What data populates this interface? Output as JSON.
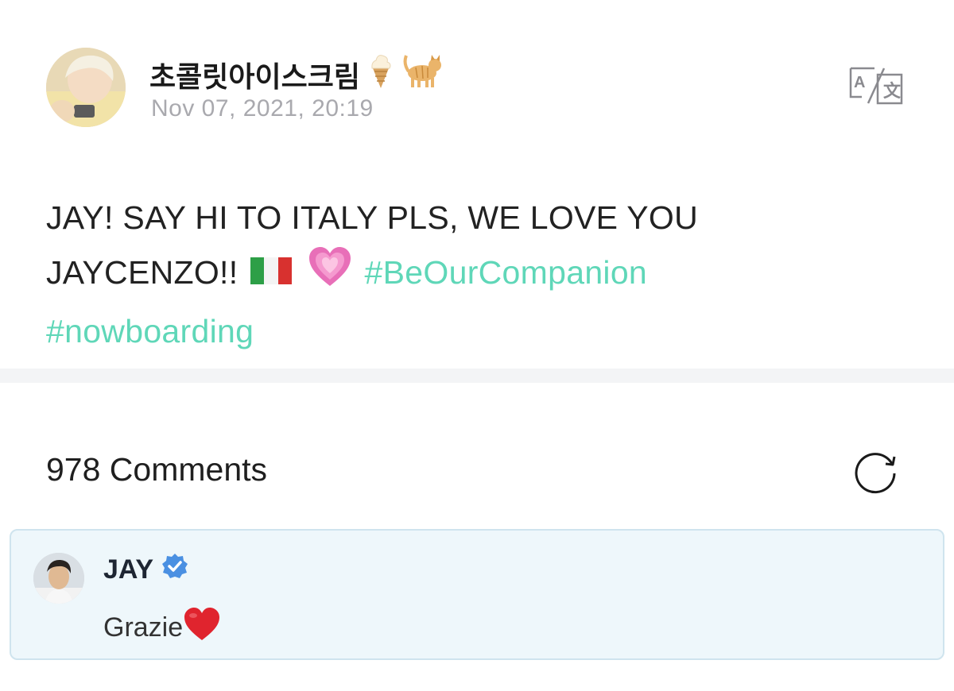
{
  "post": {
    "author_name": "초콜릿아이스크림",
    "author_emojis": [
      "ice-cream-icon",
      "cat-icon"
    ],
    "date": "Nov 07, 2021, 20:19",
    "body_line1": "JAY! SAY HI TO ITALY PLS, WE LOVE YOU",
    "body_line2_text": "JAYCENZO!!",
    "body_emojis": [
      "italy-flag-icon",
      "growing-heart-icon"
    ],
    "hashtags": [
      "#BeOurCompanion",
      "#nowboarding"
    ]
  },
  "comments": {
    "count_label": "978 Comments"
  },
  "featured_comment": {
    "author": "JAY",
    "verified": true,
    "text": "Grazie",
    "text_emoji": "red-heart-icon"
  },
  "colors": {
    "hashtag": "#5fd7b8",
    "date": "#a9a9ae",
    "comment_bg": "#eef7fb",
    "comment_border": "#cfe4ee",
    "verified": "#4a90e2"
  }
}
